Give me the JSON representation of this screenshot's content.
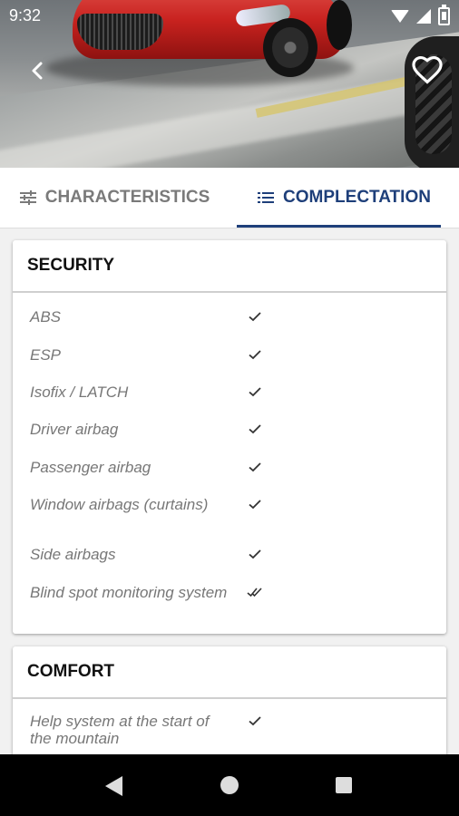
{
  "status_bar": {
    "time": "9:32"
  },
  "tabs": [
    {
      "label": "CHARACTERISTICS",
      "icon": "sliders-icon",
      "active": false
    },
    {
      "label": "COMPLECTATION",
      "icon": "list-icon",
      "active": true
    }
  ],
  "sections": [
    {
      "title": "SECURITY",
      "items": [
        {
          "label": "ABS",
          "mark": "check"
        },
        {
          "label": "ESP",
          "mark": "check"
        },
        {
          "label": "Isofix / LATCH",
          "mark": "check"
        },
        {
          "label": "Driver airbag",
          "mark": "check"
        },
        {
          "label": "Passenger airbag",
          "mark": "check"
        },
        {
          "label": "Window airbags (curtains)",
          "mark": "check"
        },
        {
          "label": "Side airbags",
          "mark": "check"
        },
        {
          "label": "Blind spot monitoring system",
          "mark": "double-check"
        }
      ]
    },
    {
      "title": "COMFORT",
      "items": [
        {
          "label": "Help system at the start of the mountain",
          "mark": "check"
        }
      ]
    }
  ],
  "colors": {
    "accent": "#1e3f7a",
    "inactive_tab": "#7a7a7a",
    "item_text": "#777777"
  }
}
